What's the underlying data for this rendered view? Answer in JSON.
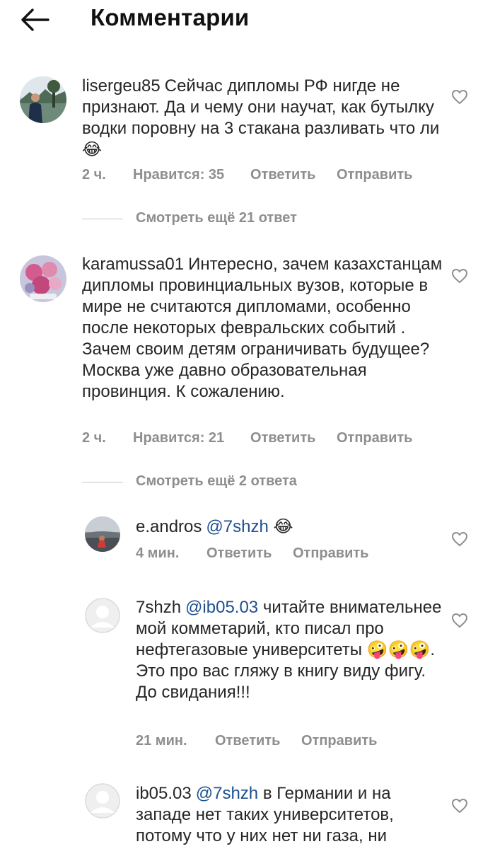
{
  "header": {
    "title": "Комментарии",
    "back_icon": "back-arrow-icon"
  },
  "comments": [
    {
      "user": "lisergeu85",
      "mention": "",
      "text": "Сейчас дипломы РФ нигде не признают. Да и чему они научат, как бутылку водки поровну на 3 стакана разливать что ли 😂",
      "time": "2 ч.",
      "likes": "Нравится: 35",
      "reply": "Ответить",
      "send": "Отправить",
      "more_replies": "Смотреть ещё 21 ответ"
    },
    {
      "user": "karamussa01",
      "mention": "",
      "text": "Интересно, зачем казахстанцам дипломы провинциальных вузов, которые в мире не считаются дипломами, особенно после некоторых февральских событий . Зачем своим детям ограничивать будущее? Москва уже давно образовательная провинция. К сожалению.",
      "time": "2 ч.",
      "likes": "Нравится: 21",
      "reply": "Ответить",
      "send": "Отправить",
      "more_replies": "Смотреть ещё 2 ответа"
    },
    {
      "user": "e.andros",
      "mention": "@7shzh",
      "text": "😂",
      "time": "4 мин.",
      "reply": "Ответить",
      "send": "Отправить"
    },
    {
      "user": "7shzh",
      "mention": "@ib05.03",
      "text": "читайте внимательнее мой комметарий, кто писал про нефтегазовые университеты 🤪🤪🤪. Это про вас гляжу в книгу виду фигу. До свидания!!!",
      "time": "21 мин.",
      "reply": "Ответить",
      "send": "Отправить"
    },
    {
      "user": "ib05.03",
      "mention": "@7shzh",
      "text": "в Германии и на западе нет таких университетов, потому что у них нет ни газа, ни",
      "reply": "",
      "send": ""
    }
  ],
  "colors": {
    "mention": "#1d4f91",
    "meta": "#8e8e8e",
    "text": "#262626"
  }
}
